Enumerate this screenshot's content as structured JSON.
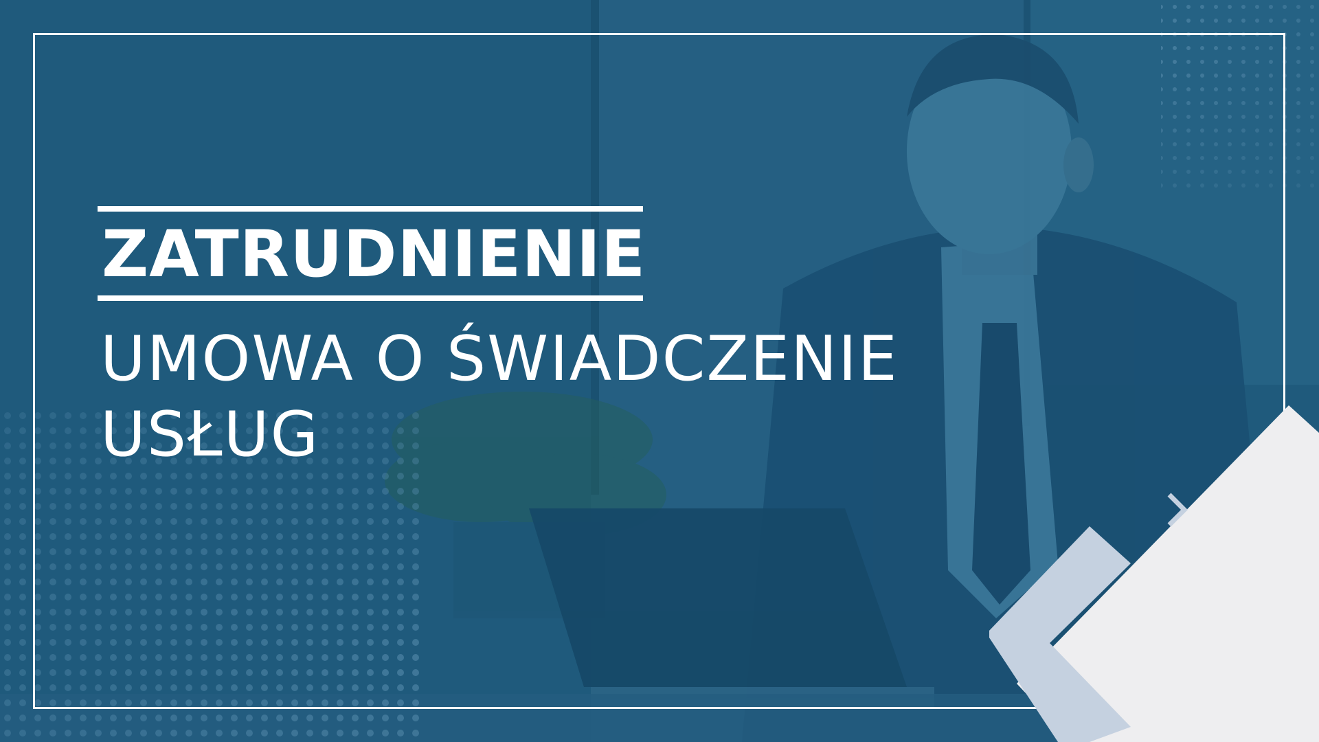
{
  "colors": {
    "background": "#1f5a7c",
    "frame": "#ffffff",
    "panel_light": "#eeeef0",
    "panel_accent": "#c5d1e0"
  },
  "icons": {
    "dots": "halftone-dots-icon",
    "arrow": "chevron-right-icon"
  },
  "category": "ZATRUDNIENIE",
  "headline": {
    "line1": "UMOWA O ŚWIADCZENIE",
    "line2": "USŁUG"
  }
}
